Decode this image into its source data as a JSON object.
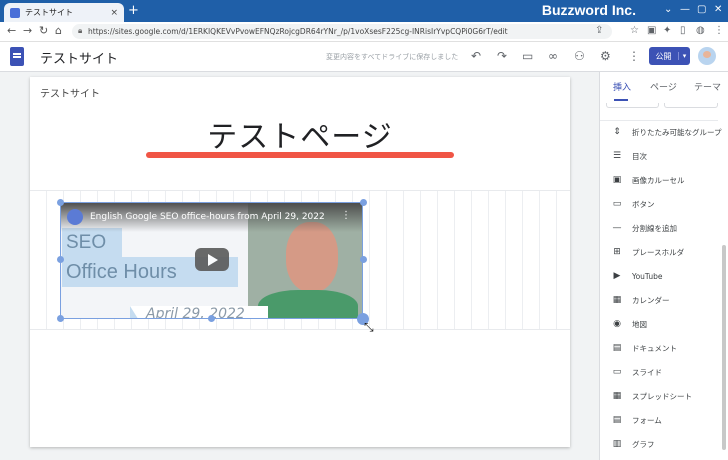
{
  "browser": {
    "tab_title": "テストサイト",
    "tab_close": "×",
    "new_tab": "+",
    "brand": "Buzzword Inc.",
    "url": "https://sites.google.com/d/1ERKIQKEVvPvowEFNQzRojcgDR64rYNr_/p/1voXsesF225cg-INRisIrYvpCQPi0G6rT/edit"
  },
  "header": {
    "site_name": "テストサイト",
    "saved_status": "変更内容をすべてドライブに保存しました",
    "publish_label": "公開"
  },
  "page": {
    "header_label": "テストサイト",
    "title": "テストページ"
  },
  "video": {
    "title": "English Google SEO office-hours from April 29, 2022",
    "text_seo": "SEO",
    "text_office_hours": "Office Hours",
    "text_date": "April 29, 2022"
  },
  "panel": {
    "tabs": [
      "挿入",
      "ページ",
      "テーマ"
    ],
    "active_tab": "挿入",
    "items": [
      {
        "icon": "collapsible-group-icon",
        "glyph": "⇕",
        "label": "折りたたみ可能なグループ"
      },
      {
        "icon": "toc-icon",
        "glyph": "☰",
        "label": "目次"
      },
      {
        "icon": "carousel-icon",
        "glyph": "▣",
        "label": "画像カルーセル"
      },
      {
        "icon": "button-icon",
        "glyph": "▭",
        "label": "ボタン"
      },
      {
        "icon": "divider-icon",
        "glyph": "—",
        "label": "分割線を追加"
      },
      {
        "icon": "placeholder-icon",
        "glyph": "⊞",
        "label": "プレースホルダ"
      },
      {
        "icon": "youtube-icon",
        "glyph": "▶",
        "label": "YouTube"
      },
      {
        "icon": "calendar-icon",
        "glyph": "▦",
        "label": "カレンダー"
      },
      {
        "icon": "map-pin-icon",
        "glyph": "◉",
        "label": "地図"
      },
      {
        "icon": "docs-icon",
        "glyph": "▤",
        "label": "ドキュメント"
      },
      {
        "icon": "slides-icon",
        "glyph": "▭",
        "label": "スライド"
      },
      {
        "icon": "sheets-icon",
        "glyph": "▦",
        "label": "スプレッドシート"
      },
      {
        "icon": "forms-icon",
        "glyph": "▤",
        "label": "フォーム"
      },
      {
        "icon": "chart-icon",
        "glyph": "▥",
        "label": "グラフ"
      }
    ]
  },
  "colors": {
    "titlebar": "#1f5fa8",
    "accent": "#3c52b5",
    "title_underline": "#f05545",
    "selection": "#7aa0e0"
  }
}
